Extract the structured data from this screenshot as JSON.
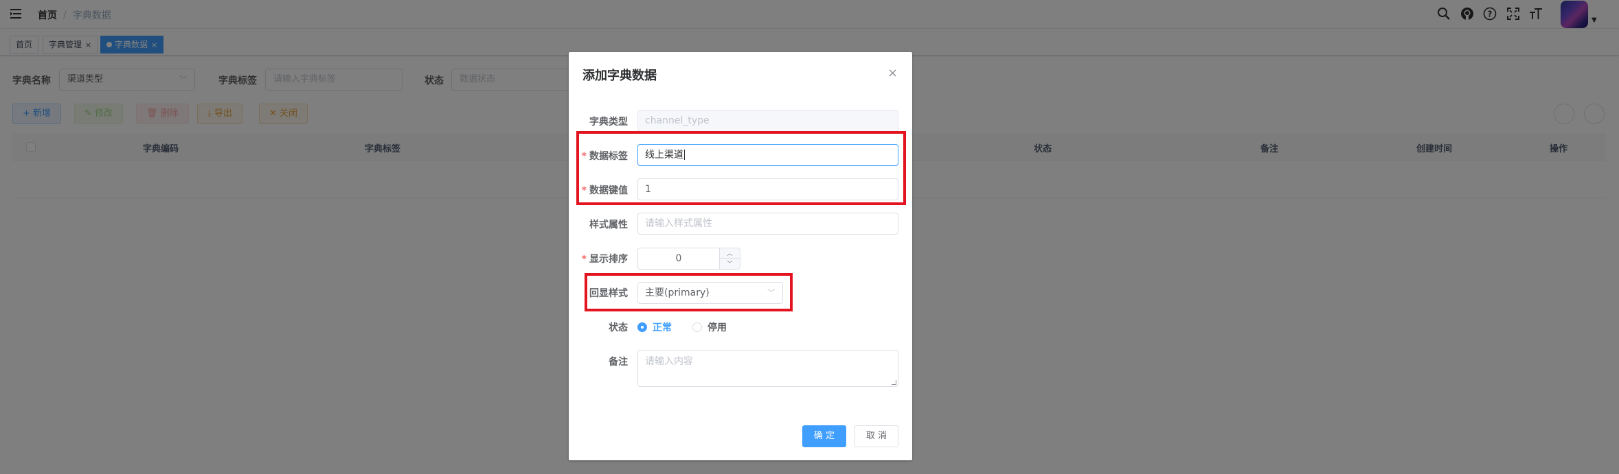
{
  "navbar": {
    "breadcrumb": {
      "home": "首页",
      "separator": "/",
      "current": "字典数据"
    }
  },
  "tags": [
    {
      "label": "首页",
      "closable": false,
      "active": false
    },
    {
      "label": "字典管理",
      "closable": true,
      "active": false
    },
    {
      "label": "字典数据",
      "closable": true,
      "active": true
    }
  ],
  "tag_close": "×",
  "search": {
    "dict_name_label": "字典名称",
    "dict_name_value": "渠道类型",
    "dict_label_label": "字典标签",
    "dict_label_placeholder": "请输入字典标签",
    "status_label": "状态",
    "status_placeholder": "数据状态"
  },
  "toolbar": {
    "add": "新增",
    "edit": "修改",
    "delete": "删除",
    "export": "导出",
    "close": "关闭"
  },
  "table": {
    "columns": [
      "字典编码",
      "字典标签",
      "状态",
      "备注",
      "创建时间",
      "操作"
    ]
  },
  "dialog": {
    "title": "添加字典数据",
    "close": "×",
    "dict_type_label": "字典类型",
    "dict_type_value": "channel_type",
    "data_label_label": "数据标签",
    "data_label_value": "线上渠道",
    "data_value_label": "数据键值",
    "data_value_value": "1",
    "css_class_label": "样式属性",
    "css_class_placeholder": "请输入样式属性",
    "sort_label": "显示排序",
    "sort_value": "0",
    "list_class_label": "回显样式",
    "list_class_value": "主要(primary)",
    "status_label": "状态",
    "status_options": [
      "正常",
      "停用"
    ],
    "status_selected": "正常",
    "remark_label": "备注",
    "remark_placeholder": "请输入内容",
    "required_mark": "*",
    "confirm": "确 定",
    "cancel": "取 消"
  },
  "colors": {
    "primary": "#409eff",
    "annotation_red": "#e3141f",
    "overlay": "rgba(0,0,0,0.5)"
  },
  "icons": [
    "hamburger-icon",
    "search-icon",
    "github-icon",
    "help-icon",
    "fullscreen-icon",
    "font-size-icon",
    "chevron-down-icon",
    "plus-icon",
    "edit-icon",
    "delete-icon",
    "download-icon",
    "close-icon",
    "refresh-icon"
  ]
}
